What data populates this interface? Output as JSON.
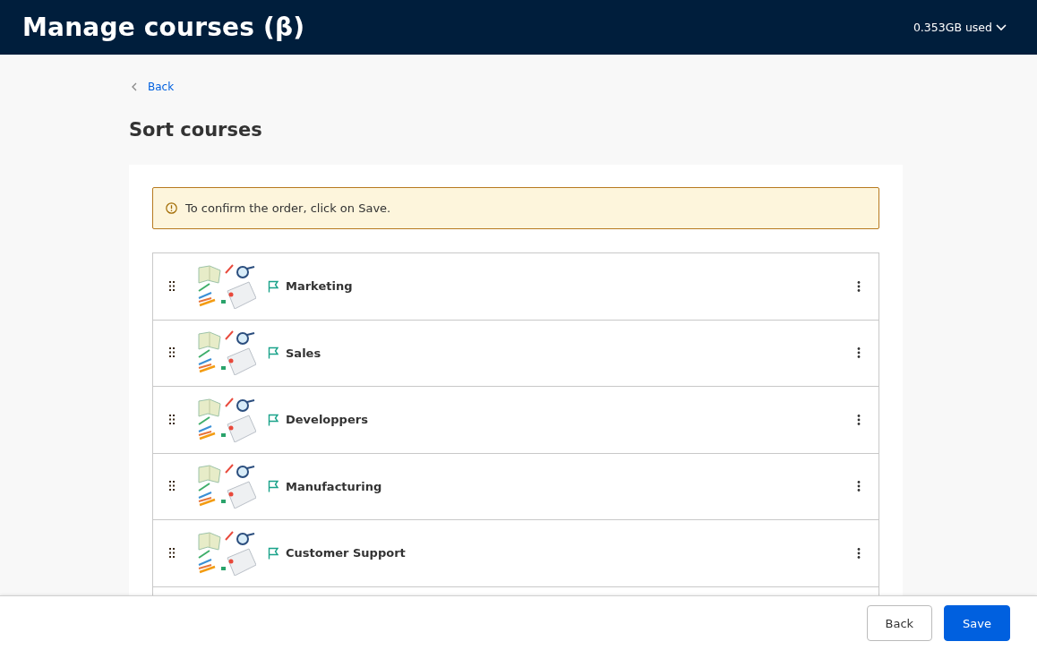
{
  "header": {
    "title": "Manage courses (β)",
    "storage": "0.353GB used"
  },
  "back_link": "Back",
  "page_title": "Sort courses",
  "alert": {
    "kind": "warning",
    "message": "To confirm the order, click on Save."
  },
  "courses": [
    {
      "name": "Marketing"
    },
    {
      "name": "Sales"
    },
    {
      "name": "Developpers"
    },
    {
      "name": "Manufacturing"
    },
    {
      "name": "Customer Support"
    }
  ],
  "footer": {
    "buttons": [
      {
        "label": "Back",
        "kind": "secondary"
      },
      {
        "label": "Save",
        "kind": "primary"
      }
    ]
  }
}
